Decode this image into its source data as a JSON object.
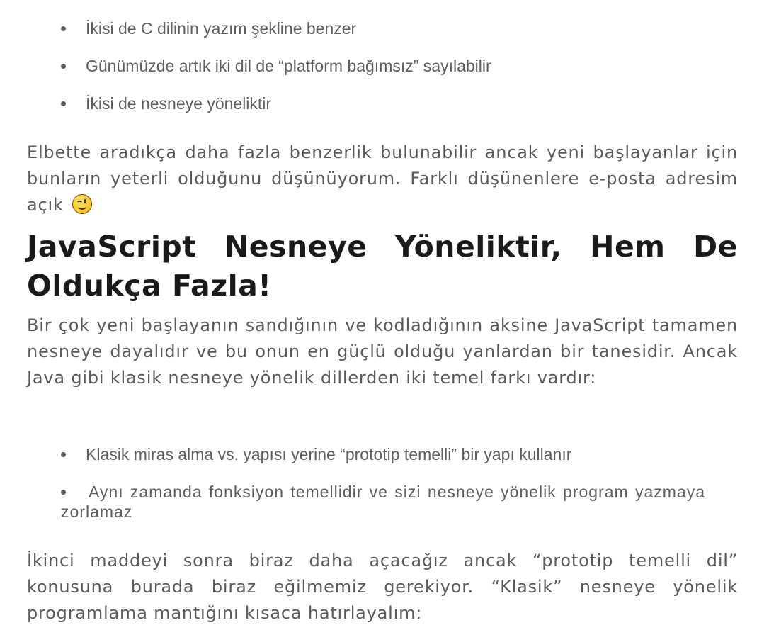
{
  "list1": [
    "İkisi de C dilinin yazım şekline benzer",
    "Günümüzde artık iki dil de “platform bağımsız” sayılabilir",
    "İkisi de nesneye yöneliktir"
  ],
  "para1": {
    "text": "Elbette aradıkça daha fazla benzerlik bulunabilir ancak yeni başlayanlar için bunların yeterli olduğunu düşünüyorum. Farklı düşünenlere e-posta adresim açık",
    "emoji": "winking-face-emoji"
  },
  "heading": {
    "line1_words": [
      "JavaScript",
      "Nesneye",
      "Yöneliktir,",
      "Hem",
      "De"
    ],
    "line2": "Oldukça Fazla!"
  },
  "para2": "Bir çok yeni başlayanın sandığının ve kodladığının aksine JavaScript tamamen nesneye dayalıdır ve bu onun en güçlü olduğu yanlardan bir tanesidir. Ancak Java gibi klasik nesneye yönelik dillerden iki temel farkı vardır:",
  "list2": [
    "Klasik miras alma vs. yapısı yerine “prototip temelli” bir yapı kullanır",
    "Aynı zamanda fonksiyon temellidir ve sizi nesneye yönelik program yazmaya zorlamaz"
  ],
  "para3": "İkinci maddeyi sonra biraz daha açacağız ancak “prototip temelli dil” konusuna burada biraz eğilmemiz gerekiyor. “Klasik” nesneye yönelik programlama mantığını kısaca hatırlayalım:"
}
